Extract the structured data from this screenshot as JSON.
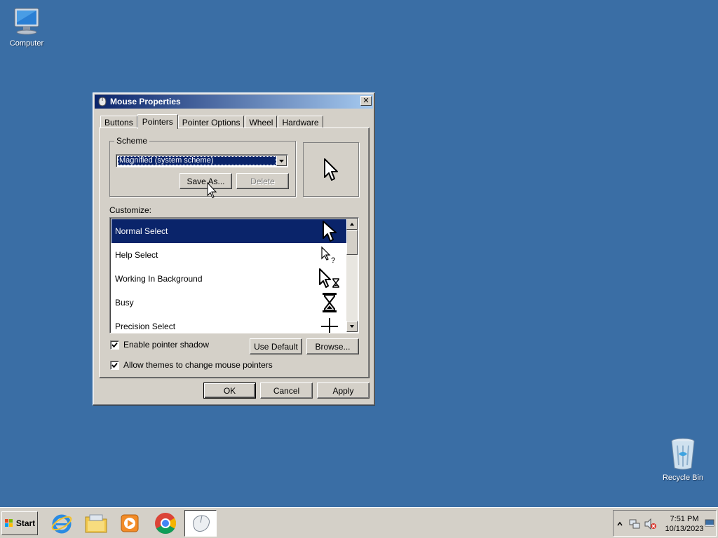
{
  "desktop": {
    "computer_label": "Computer",
    "recycle_label": "Recycle Bin"
  },
  "dialog": {
    "title": "Mouse Properties",
    "close_glyph": "✕",
    "tabs": [
      {
        "label": "Buttons"
      },
      {
        "label": "Pointers",
        "active": true
      },
      {
        "label": "Pointer Options"
      },
      {
        "label": "Wheel"
      },
      {
        "label": "Hardware"
      }
    ],
    "scheme": {
      "group_label": "Scheme",
      "selected": "Magnified (system scheme)",
      "save_as_label": "Save As...",
      "delete_label": "Delete"
    },
    "customize_label": "Customize:",
    "cursors": [
      {
        "name": "Normal Select",
        "icon": "arrow-cursor-icon",
        "selected": true
      },
      {
        "name": "Help Select",
        "icon": "help-cursor-icon"
      },
      {
        "name": "Working In Background",
        "icon": "working-cursor-icon"
      },
      {
        "name": "Busy",
        "icon": "hourglass-icon"
      },
      {
        "name": "Precision Select",
        "icon": "crosshair-icon"
      }
    ],
    "enable_shadow_label": "Enable pointer shadow",
    "enable_shadow_checked": true,
    "allow_themes_label": "Allow themes to change mouse pointers",
    "allow_themes_checked": true,
    "use_default_label": "Use Default",
    "browse_label": "Browse...",
    "ok_label": "OK",
    "cancel_label": "Cancel",
    "apply_label": "Apply"
  },
  "taskbar": {
    "start_label": "Start",
    "clock_time": "7:51 PM",
    "clock_date": "10/13/2023",
    "pinned": [
      "ie-icon",
      "explorer-icon",
      "media-player-icon",
      "chrome-icon",
      "mouse-icon"
    ]
  },
  "colors": {
    "desktop": "#3a6ea5",
    "selection": "#0a246a",
    "face": "#d4d0c8"
  }
}
